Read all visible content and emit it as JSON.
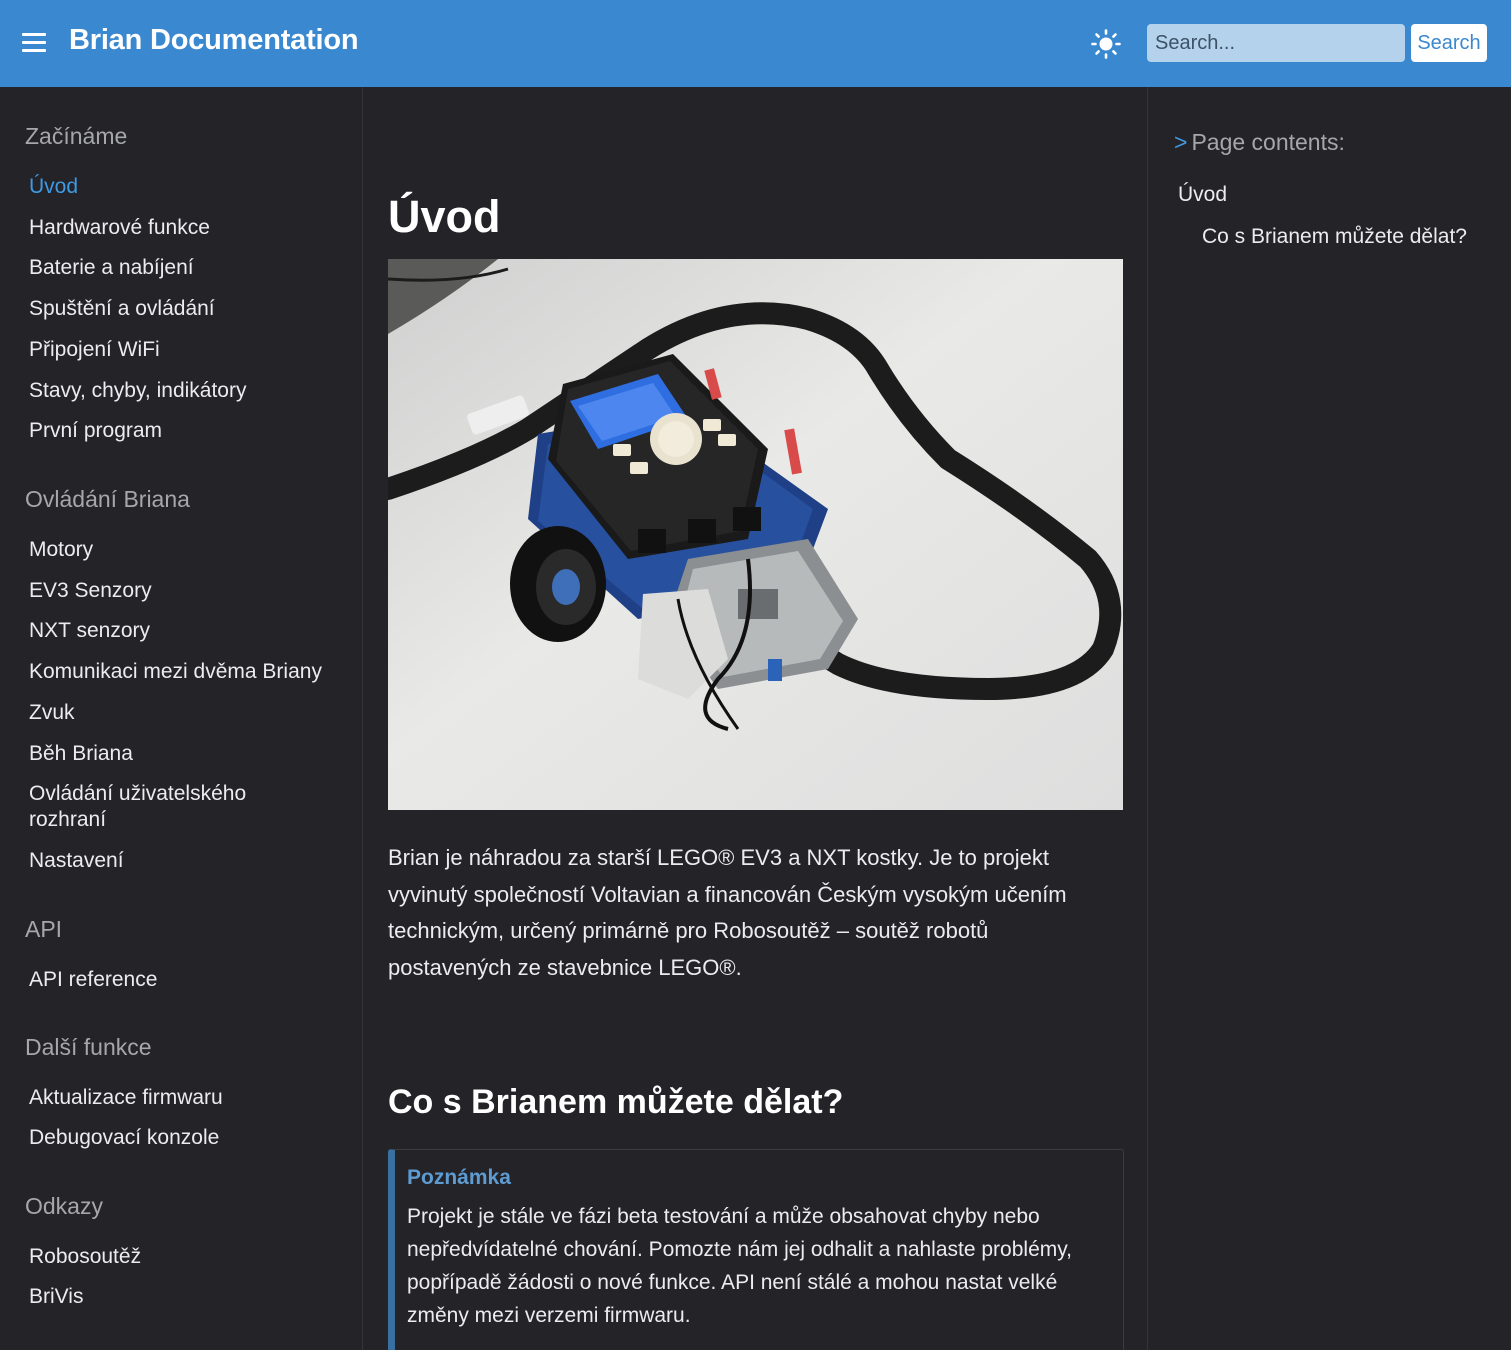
{
  "header": {
    "title": "Brian Documentation",
    "search_placeholder": "Search...",
    "search_button": "Search"
  },
  "sidebar": {
    "sections": [
      {
        "title": "Začínáme",
        "items": [
          "Úvod",
          "Hardwarové funkce",
          "Baterie a nabíjení",
          "Spuštění a ovládání",
          "Připojení WiFi",
          "Stavy, chyby, indikátory",
          "První program"
        ]
      },
      {
        "title": "Ovládání Briana",
        "items": [
          "Motory",
          "EV3 Senzory",
          "NXT senzory",
          "Komunikaci mezi dvěma Briany",
          "Zvuk",
          "Běh Briana",
          "Ovládání uživatelského rozhraní",
          "Nastavení"
        ]
      },
      {
        "title": "API",
        "items": [
          "API reference"
        ]
      },
      {
        "title": "Další funkce",
        "items": [
          "Aktualizace firmwaru",
          "Debugovací konzole"
        ]
      },
      {
        "title": "Odkazy",
        "items": [
          "Robosoutěž",
          "BriVis"
        ]
      }
    ],
    "active_item": "Úvod"
  },
  "main": {
    "title": "Úvod",
    "paragraph": "Brian je náhradou za starší LEGO® EV3 a NXT kostky. Je to projekt vyvinutý společností Voltavian a financován Českým vysokým učením technickým, určený primárně pro Robosoutěž – soutěž robotů postavených ze stavebnice LEGO®.",
    "section_heading": "Co s Brianem můžete dělat?",
    "note": {
      "title": "Poznámka",
      "text": "Projekt je stále ve fázi beta testování a může obsahovat chyby nebo nepředvídatelné chování. Pomozte nám jej odhalit a nahlaste problémy, popřípadě žádosti o nové funkce. API není stálé a mohou nastat velké změny mezi verzemi firmwaru."
    }
  },
  "toc": {
    "title": "Page contents:",
    "chevron": ">",
    "items": [
      "Úvod",
      "Co s Brianem můžete dělat?"
    ]
  },
  "colors": {
    "header_bg": "#3a88cf",
    "page_bg": "#232328",
    "accent": "#3f9ae3",
    "note_border": "#3a6fa1"
  }
}
